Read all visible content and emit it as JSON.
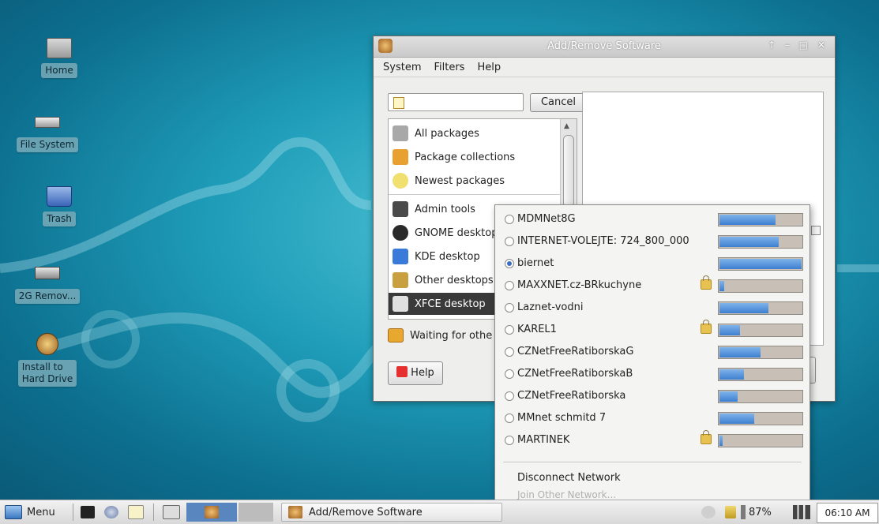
{
  "desktop": {
    "icons": [
      {
        "label": "Home",
        "icon": "home-folder-icon"
      },
      {
        "label": "File System",
        "icon": "drive-icon"
      },
      {
        "label": "Trash",
        "icon": "trash-icon"
      },
      {
        "label": "2G Remov...",
        "icon": "removable-drive-icon"
      },
      {
        "label": "Install to\nHard Drive",
        "icon": "installer-icon"
      }
    ]
  },
  "window": {
    "title": "Add/Remove Software",
    "controls": "↑ – □ ✕",
    "menu": [
      "System",
      "Filters",
      "Help"
    ],
    "search": {
      "value": "",
      "placeholder": ""
    },
    "cancel_label": "Cancel",
    "categories": [
      {
        "label": "All packages",
        "icon": "magnifier-package-icon"
      },
      {
        "label": "Package collections",
        "icon": "package-collection-icon"
      },
      {
        "label": "Newest packages",
        "icon": "lightbulb-icon"
      },
      {
        "label": "Admin tools",
        "icon": "admin-tools-icon"
      },
      {
        "label": "GNOME desktop",
        "icon": "gnome-foot-icon"
      },
      {
        "label": "KDE desktop",
        "icon": "kde-icon"
      },
      {
        "label": "Other desktops",
        "icon": "desktop-icon"
      },
      {
        "label": "XFCE desktop",
        "icon": "xfce-mouse-icon",
        "selected": true
      }
    ],
    "status_text": "Waiting for othe",
    "help_label": "Help"
  },
  "network_menu": {
    "networks": [
      {
        "name": "MDMNet8G",
        "selected": false,
        "secured": false,
        "signal": 0.68
      },
      {
        "name": "INTERNET-VOLEJTE: 724_800_000",
        "selected": false,
        "secured": false,
        "signal": 0.72
      },
      {
        "name": "biernet",
        "selected": true,
        "secured": false,
        "signal": 1.0
      },
      {
        "name": "MAXXNET.cz-BRkuchyne",
        "selected": false,
        "secured": true,
        "signal": 0.06
      },
      {
        "name": "Laznet-vodni",
        "selected": false,
        "secured": false,
        "signal": 0.6
      },
      {
        "name": "KAREL1",
        "selected": false,
        "secured": true,
        "signal": 0.25
      },
      {
        "name": "CZNetFreeRatiborskaG",
        "selected": false,
        "secured": false,
        "signal": 0.5
      },
      {
        "name": "CZNetFreeRatiborskaB",
        "selected": false,
        "secured": false,
        "signal": 0.3
      },
      {
        "name": "CZNetFreeRatiborska",
        "selected": false,
        "secured": false,
        "signal": 0.22
      },
      {
        "name": "MMnet schmitd 7",
        "selected": false,
        "secured": false,
        "signal": 0.42
      },
      {
        "name": "MARTINEK",
        "selected": false,
        "secured": true,
        "signal": 0.04
      }
    ],
    "disconnect_label": "Disconnect Network",
    "join_label": "Join Other Network..."
  },
  "taskbar": {
    "menu_label": "Menu",
    "task_label": "Add/Remove Software",
    "battery": "87%",
    "clock": "06:10 AM"
  },
  "colors": {
    "selection": "#3a3a3a",
    "signal": "#3d7fd0",
    "desktop": "#1e9cb8"
  }
}
